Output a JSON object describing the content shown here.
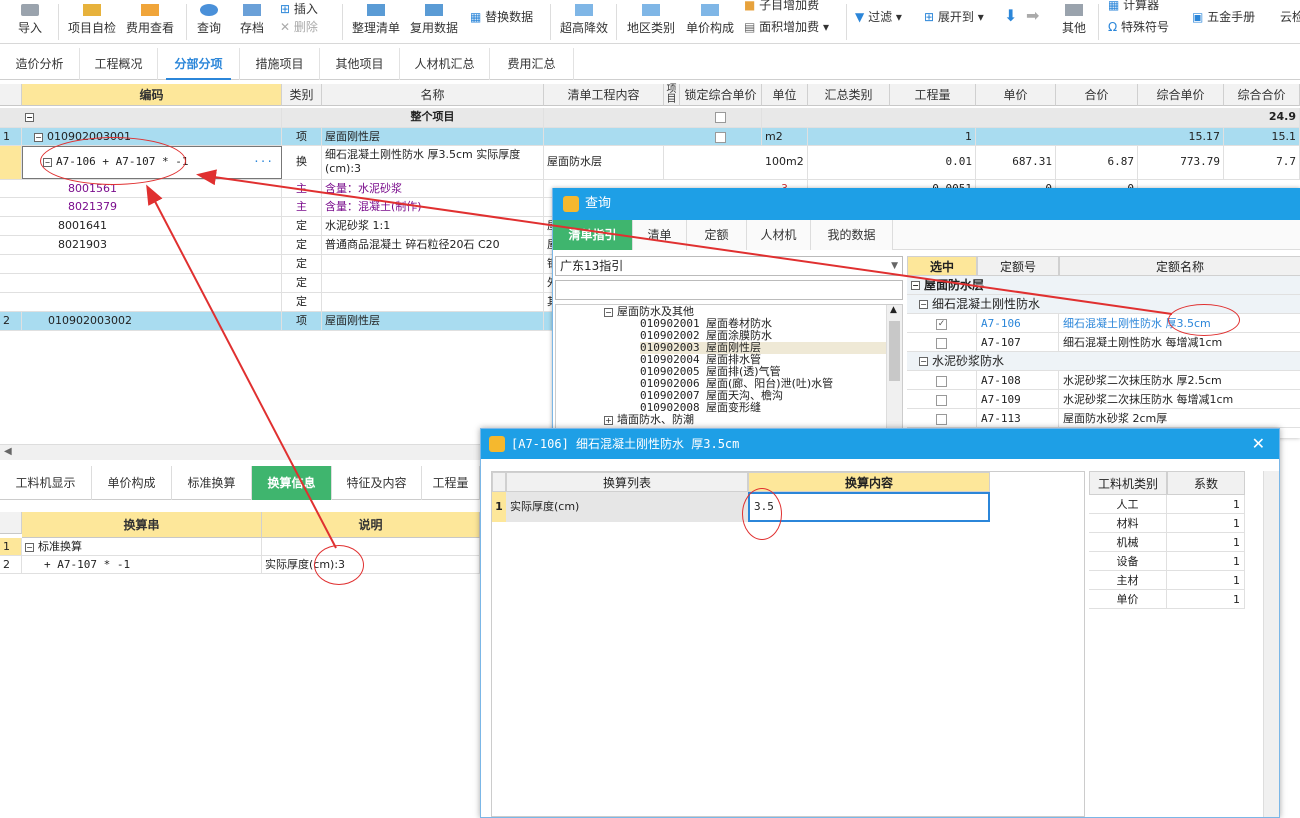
{
  "toolbar": {
    "import": "导入",
    "self_check": "项目自检",
    "fee_view": "费用查看",
    "query": "查询",
    "save": "存档",
    "insert": "插入",
    "delete": "删除",
    "organize": "整理清单",
    "reuse": "复用数据",
    "replace": "替换数据",
    "over_height": "超高降效",
    "area_cat": "地区类别",
    "unit_price": "单价构成",
    "sub_add": "子目增加费",
    "area_add": "面积增加费",
    "filter": "过滤",
    "expand": "展开到",
    "other": "其他",
    "calculator": "计算器",
    "special_symbol": "特殊符号",
    "hardware": "五金手册",
    "cloud": "云检"
  },
  "main_tabs": [
    "造价分析",
    "工程概况",
    "分部分项",
    "措施项目",
    "其他项目",
    "人材机汇总",
    "费用汇总"
  ],
  "grid": {
    "headers": [
      "编码",
      "类别",
      "名称",
      "清单工程内容",
      "项目",
      "锁定综合单价",
      "单位",
      "汇总类别",
      "工程量",
      "单价",
      "合价",
      "综合单价",
      "综合合价"
    ],
    "rows": [
      {
        "num": "",
        "code": "",
        "type": "",
        "name": "整个项目",
        "content": "",
        "unit": "",
        "qty": "",
        "price": "",
        "total": "",
        "cprice": "",
        "ctotal": "24.9"
      },
      {
        "num": "1",
        "code": "010902003001",
        "type": "项",
        "name": "屋面刚性层",
        "content": "",
        "unit": "m2",
        "qty": "1",
        "price": "",
        "total": "",
        "cprice": "15.17",
        "ctotal": "15.1"
      },
      {
        "num": "",
        "code": "A7-106 + A7-107 * -1",
        "type": "换",
        "name": "细石混凝土刚性防水 厚3.5cm  实际厚度(cm):3",
        "content": "屋面防水层",
        "unit": "100m2",
        "qty": "0.01",
        "price": "687.31",
        "total": "6.87",
        "cprice": "773.79",
        "ctotal": "7.7"
      },
      {
        "num": "",
        "code": "8001561",
        "type": "主",
        "name": "含量：水泥砂浆",
        "content": "",
        "unit": "",
        "qty": "",
        "price": "",
        "total": "",
        "cprice": "",
        "ctotal": ""
      },
      {
        "num": "",
        "code": "8021379",
        "type": "主",
        "name": "含量：混凝土(制作)",
        "content": "",
        "unit": "",
        "qty": "",
        "price": "",
        "total": "",
        "cprice": "",
        "ctotal": ""
      },
      {
        "num": "",
        "code": "8001641",
        "type": "定",
        "name": "水泥砂浆 1:1",
        "content": "屋",
        "unit": "",
        "qty": "",
        "price": "",
        "total": "",
        "cprice": "",
        "ctotal": ""
      },
      {
        "num": "",
        "code": "8021903",
        "type": "定",
        "name": "普通商品混凝土 碎石粒径20石 C20",
        "content": "屋",
        "unit": "",
        "qty": "",
        "price": "",
        "total": "",
        "cprice": "",
        "ctotal": ""
      },
      {
        "num": "",
        "code": "",
        "type": "定",
        "name": "",
        "content": "钢",
        "unit": "",
        "qty": "",
        "price": "",
        "total": "",
        "cprice": "",
        "ctotal": ""
      },
      {
        "num": "",
        "code": "",
        "type": "定",
        "name": "",
        "content": "外",
        "unit": "",
        "qty": "",
        "price": "",
        "total": "",
        "cprice": "",
        "ctotal": ""
      },
      {
        "num": "",
        "code": "",
        "type": "定",
        "name": "",
        "content": "其",
        "unit": "",
        "qty": "",
        "price": "",
        "total": "",
        "cprice": "",
        "ctotal": ""
      },
      {
        "num": "2",
        "code": "010902003002",
        "type": "项",
        "name": "屋面刚性层",
        "content": "",
        "unit": "",
        "qty": "",
        "price": "",
        "total": "",
        "cprice": "",
        "ctotal": ""
      }
    ],
    "partial_row_values": {
      "unit": "3",
      "qty": "0.0051",
      "price": "0",
      "total": "0"
    }
  },
  "bottom_tabs": [
    "工料机显示",
    "单价构成",
    "标准换算",
    "换算信息",
    "特征及内容",
    "工程量"
  ],
  "conv_info": {
    "headers": [
      "换算串",
      "说明"
    ],
    "rows": [
      {
        "num": "1",
        "str": "标准换算",
        "desc": ""
      },
      {
        "num": "2",
        "str": "+ A7-107 * -1",
        "desc": "实际厚度(cm):3"
      }
    ]
  },
  "query_dialog": {
    "title": "查询",
    "tabs": [
      "清单指引",
      "清单",
      "定额",
      "人材机",
      "我的数据"
    ],
    "region": "广东13指引",
    "tree": [
      {
        "code": "",
        "name": "屋面防水及其他"
      },
      {
        "code": "010902001",
        "name": "屋面卷材防水"
      },
      {
        "code": "010902002",
        "name": "屋面涂膜防水"
      },
      {
        "code": "010902003",
        "name": "屋面刚性层"
      },
      {
        "code": "010902004",
        "name": "屋面排水管"
      },
      {
        "code": "010902005",
        "name": "屋面排(透)气管"
      },
      {
        "code": "010902006",
        "name": "屋面(廊、阳台)泄(吐)水管"
      },
      {
        "code": "010902007",
        "name": "屋面天沟、檐沟"
      },
      {
        "code": "010902008",
        "name": "屋面变形缝"
      },
      {
        "code": "",
        "name": "墙面防水、防潮"
      }
    ],
    "right_headers": [
      "选中",
      "定额号",
      "定额名称"
    ],
    "groups": [
      {
        "label": "屋面防水层"
      },
      {
        "label": "细石混凝土刚性防水"
      },
      {
        "label": "水泥砂浆防水"
      }
    ],
    "items": [
      {
        "code": "A7-106",
        "name": "细石混凝土刚性防水 厚3.5cm",
        "checked": true
      },
      {
        "code": "A7-107",
        "name": "细石混凝土刚性防水 每增减1cm",
        "checked": false
      },
      {
        "code": "A7-108",
        "name": "水泥砂浆二次抹压防水 厚2.5cm",
        "checked": false
      },
      {
        "code": "A7-109",
        "name": "水泥砂浆二次抹压防水 每增减1cm",
        "checked": false
      },
      {
        "code": "A7-113",
        "name": "屋面防水砂浆 2cm厚",
        "checked": false
      }
    ]
  },
  "conv_dialog": {
    "title": "[A7-106] 细石混凝土刚性防水 厚3.5cm",
    "headers": [
      "换算列表",
      "换算内容"
    ],
    "row": {
      "num": "1",
      "label": "实际厚度(cm)",
      "value": "3.5"
    },
    "coef_headers": [
      "工料机类别",
      "系数"
    ],
    "coefs": [
      {
        "cat": "人工",
        "val": "1"
      },
      {
        "cat": "材料",
        "val": "1"
      },
      {
        "cat": "机械",
        "val": "1"
      },
      {
        "cat": "设备",
        "val": "1"
      },
      {
        "cat": "主材",
        "val": "1"
      },
      {
        "cat": "单价",
        "val": "1"
      }
    ]
  },
  "colors": {
    "accent": "#2b86d9",
    "green": "#3fb56e",
    "dialog_title": "#1e9fe6",
    "header_yellow": "#fde79a",
    "selected_row": "#a9dcf0",
    "annotation": "#e03030"
  }
}
